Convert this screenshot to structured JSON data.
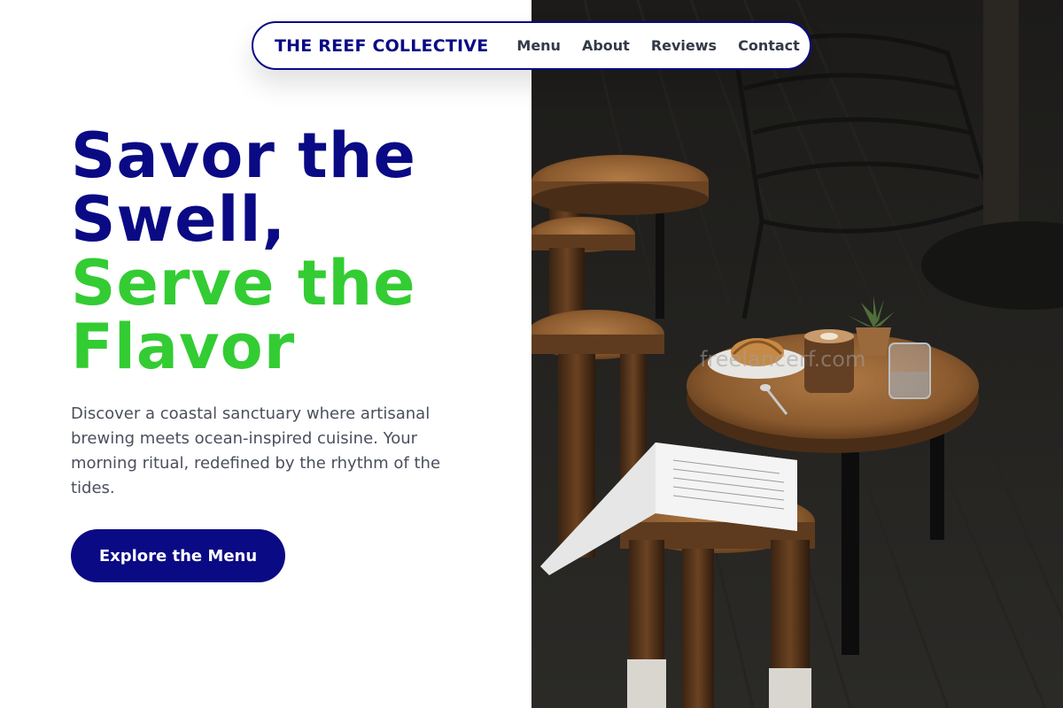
{
  "nav": {
    "brand": "THE REEF COLLECTIVE",
    "links": [
      "Menu",
      "About",
      "Reviews",
      "Contact"
    ]
  },
  "hero": {
    "headline_line1": "Savor the",
    "headline_line2": "Swell,",
    "headline_line3": "Serve the",
    "headline_line4": "Flavor",
    "description": "Discover a coastal sanctuary where artisanal brewing meets ocean-inspired cuisine. Your morning ritual, redefined by the rhythm of the tides.",
    "cta_label": "Explore the Menu"
  },
  "photo": {
    "watermark": "freelancerf.com"
  },
  "colors": {
    "primary": "#0a0a85",
    "accent": "#33cc33",
    "text_muted": "#4a4f5c"
  }
}
